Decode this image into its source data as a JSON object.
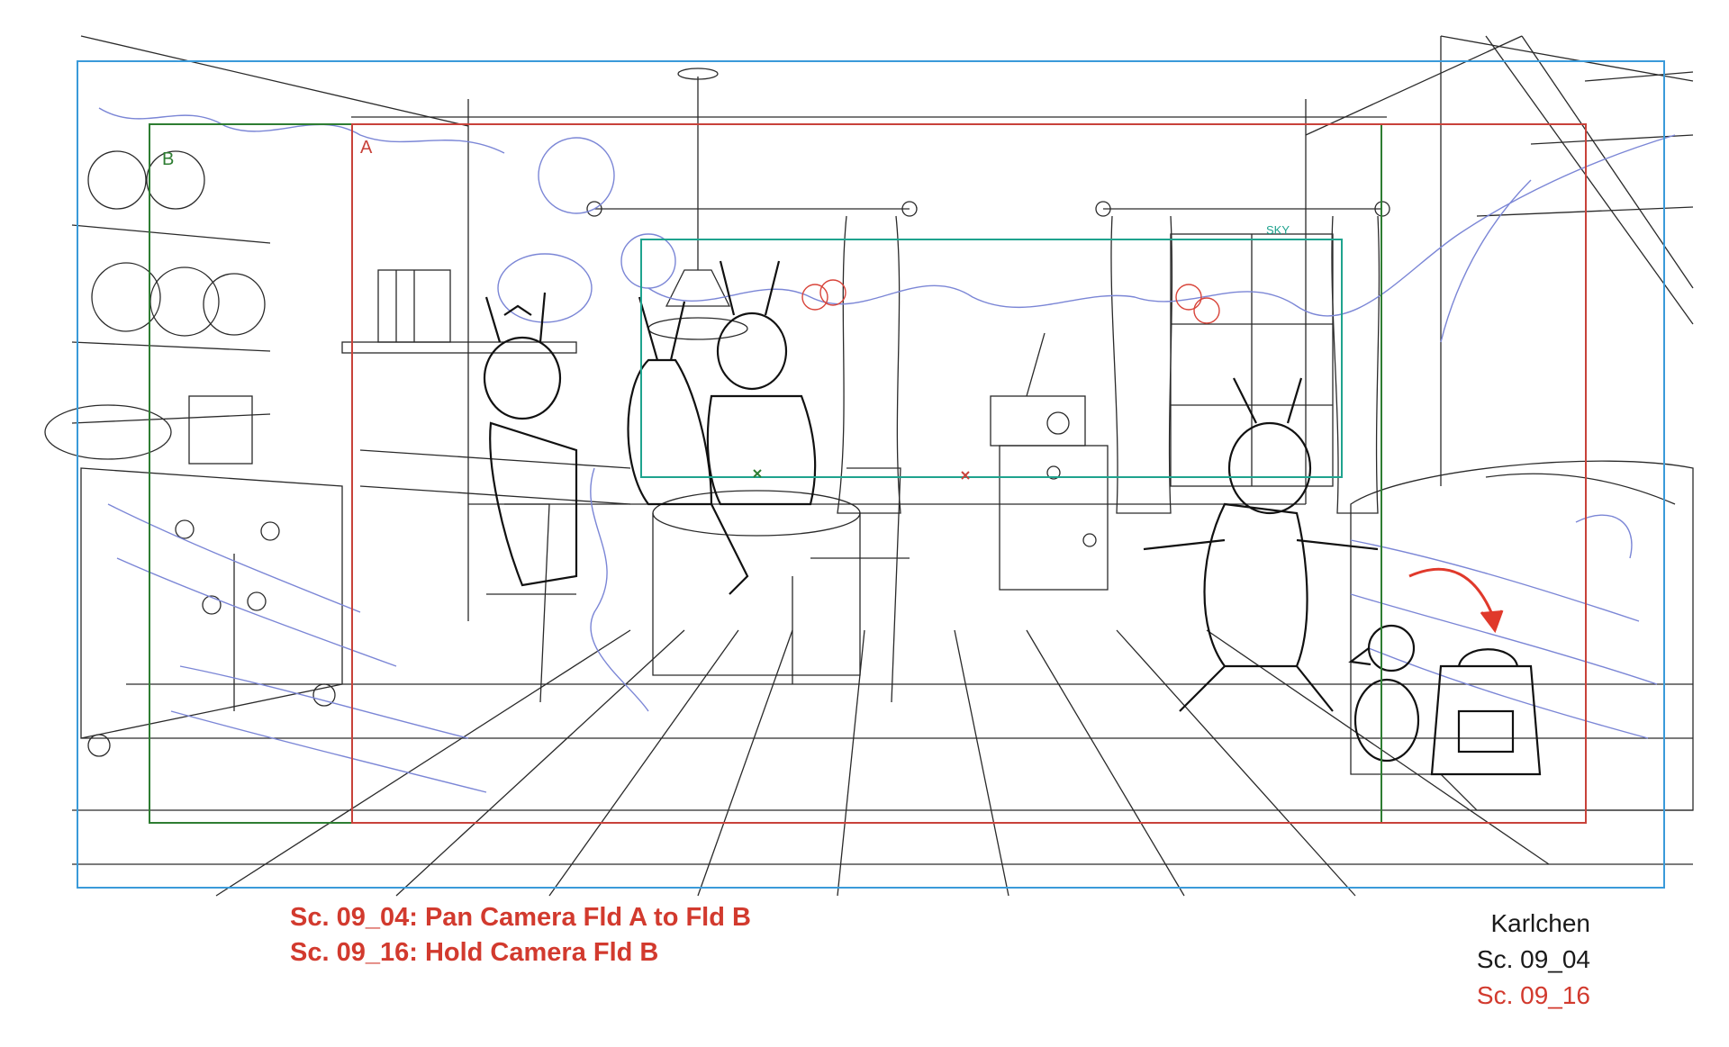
{
  "production_notes": {
    "line_1": "Sc. 09_04: Pan Camera Fld A to Fld B",
    "line_2": "Sc. 09_16: Hold Camera Fld B"
  },
  "slate": {
    "title": "Karlchen",
    "scene_1": "Sc. 09_04",
    "scene_2": "Sc. 09_16"
  },
  "field_labels": {
    "field_a": "A",
    "field_b": "B",
    "sky": "SKY"
  },
  "colors": {
    "note_red": "#d23a2e",
    "field_blue": "#3a9ad9",
    "field_red": "#c8423a",
    "field_green": "#2e7d32",
    "field_teal": "#1fa38e",
    "sketch_blue": "#7b86d6",
    "ink": "#1a1a1a"
  }
}
